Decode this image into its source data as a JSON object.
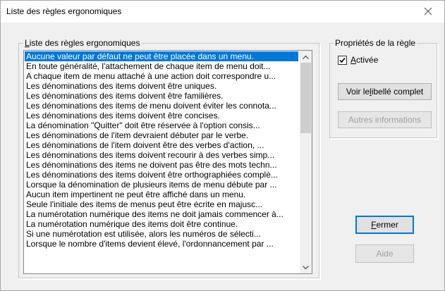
{
  "window": {
    "title": "Liste des règles ergonomiques"
  },
  "list_group": {
    "legend_first": "L",
    "legend_rest": "iste des règles ergonomiques"
  },
  "rules": [
    "Aucune valeur par défaut ne peut être placée dans un menu.",
    "En toute généralité, l'attachement de chaque item de menu doit...",
    "A chaque item de menu attaché à une action doit correspondre u...",
    "Les dénominations des items doivent être uniques.",
    "Les dénominations des items doivent être familières.",
    "Les dénominations des items de menu doivent éviter les connota...",
    "Les dénominations des items doivent être concises.",
    "La dénomination \"Quitter\" doit être réservée à l'option consis...",
    "Les dénominations de l'item devraient débuter par le verbe.",
    "Les dénominations de l'item doivent être des verbes d'action, ...",
    "Les dénominations des items doivent recourir à des verbes simp...",
    "Les dénominations des items ne doivent pas être des mots techn...",
    "Les dénominations des items doivent être orthographiées complè...",
    "Lorsque la dénomination de plusieurs items de menu débute par ...",
    "Aucun item impertinent ne peut être affiché dans un menu.",
    "Seule l'initiale des items de menus peut être écrite en majusc...",
    "La numérotation numérique des items ne doit jamais commencer à...",
    "La numérotation numérique des items doit être continue.",
    "Si une numérotation est utilisée, alors les numéros de sélecti...",
    "Lorsque le nombre d'items devient élevé, l'ordonnancement par ..."
  ],
  "selected_index": 0,
  "props_group": {
    "legend": "Propriétés de la règle",
    "checkbox_first": "A",
    "checkbox_rest": "ctivée",
    "checkbox_checked": true
  },
  "buttons": {
    "libelle_pre": "Voir le ",
    "libelle_u": "l",
    "libelle_post": "ibellé complet",
    "autres": "Autres informations",
    "fermer_u": "F",
    "fermer_rest": "ermer",
    "aide": "Aide"
  },
  "colors": {
    "selection": "#0078d7",
    "window_bg": "#f0f0f0"
  }
}
